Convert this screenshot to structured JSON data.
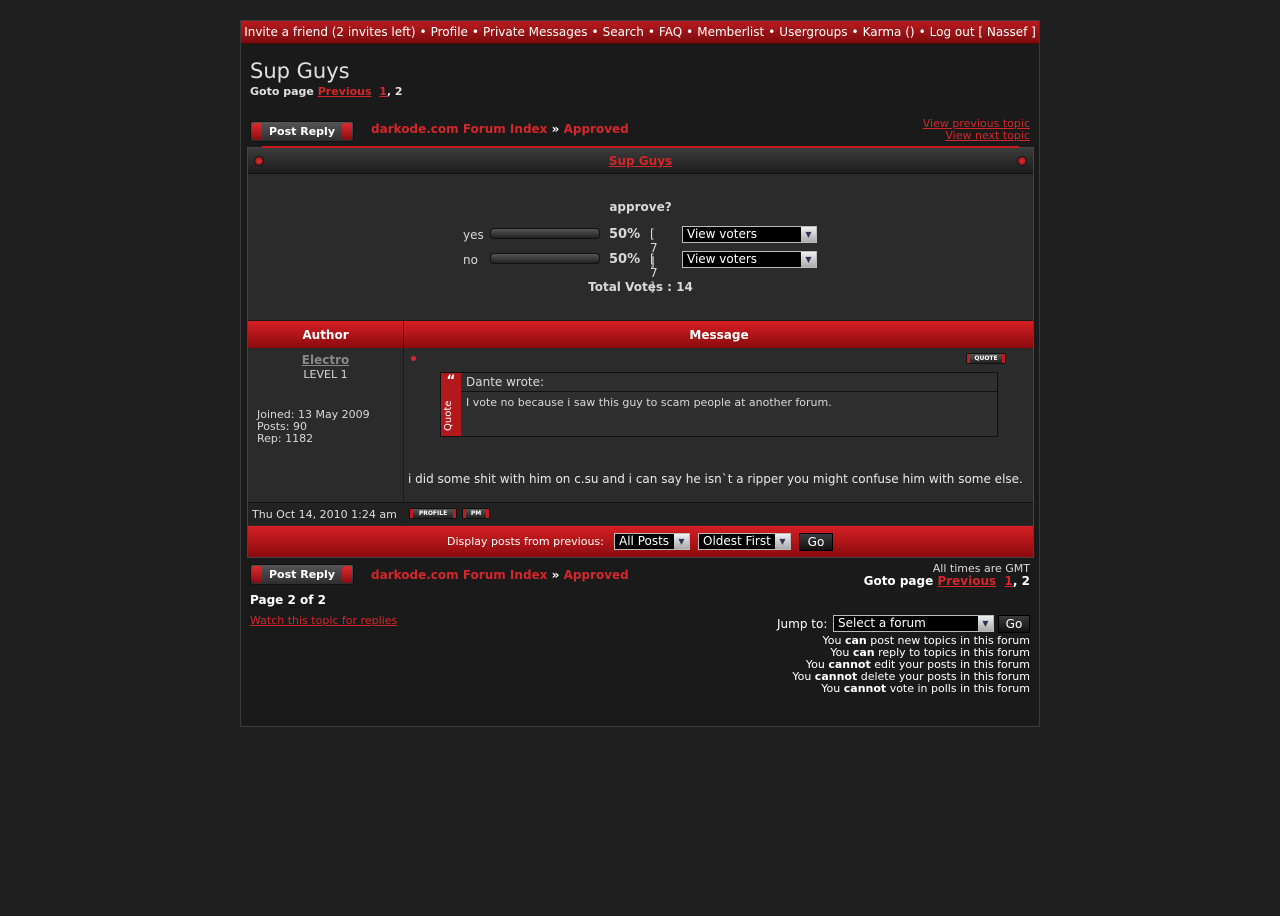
{
  "nav": {
    "invite": "Invite a friend (2 invites left)",
    "profile": "Profile",
    "pm": "Private Messages",
    "search": "Search",
    "faq": "FAQ",
    "memberlist": "Memberlist",
    "usergroups": "Usergroups",
    "karma": "Karma ()",
    "logout": "Log out [ Nassef ]",
    "sep": "•"
  },
  "topic": {
    "title": "Sup Guys",
    "goto_label": "Goto page",
    "previous": "Previous",
    "page1": "1",
    "page_sep": ",",
    "page2": "2"
  },
  "actions": {
    "post_reply": "Post Reply",
    "forum_index": "darkode.com Forum Index",
    "crumb_sep": "»",
    "forum": "Approved",
    "view_previous": "View previous topic",
    "view_next": "View next topic"
  },
  "poll": {
    "header": "Sup Guys",
    "question": "approve?",
    "options": [
      {
        "label": "yes",
        "percent": "50%",
        "count": "[ 7 ]",
        "select": "View voters"
      },
      {
        "label": "no",
        "percent": "50%",
        "count": "[ 7 ]",
        "select": "View voters"
      }
    ],
    "total": "Total Votes : 14"
  },
  "table": {
    "author_header": "Author",
    "message_header": "Message"
  },
  "post": {
    "username": "Electro",
    "level": "LEVEL 1",
    "joined": "Joined: 13 May 2009",
    "posts": "Posts: 90",
    "rep": "Rep: 1182",
    "quote_btn": "QUOTE",
    "quote_author": "Dante wrote:",
    "quote_side": "Quote",
    "quote_mark": "“",
    "quote_text": "I vote no because i saw this guy to scam people at another forum.",
    "text": "i did some shit with him on c.su and i can say he isn`t a ripper you might confuse him with some else.",
    "date": "Thu Oct 14, 2010 1:24 am",
    "profile_btn": "PROFILE",
    "pm_btn": "PM"
  },
  "display": {
    "label": "Display posts from previous:",
    "posts_select": "All Posts",
    "order_select": "Oldest First",
    "go": "Go",
    "arrow": "▼"
  },
  "footer": {
    "times": "All times are GMT",
    "goto_label": "Goto page",
    "previous": "Previous",
    "page1": "1",
    "page_sep": ",",
    "page2": "2",
    "page_of": "Page 2 of 2",
    "watch": "Watch this topic for replies",
    "jump_label": "Jump to:",
    "jump_select": "Select a forum",
    "jump_go": "Go",
    "you": "You",
    "can": "can",
    "cannot": "cannot",
    "perm1": "post new topics in this forum",
    "perm2": "reply to topics in this forum",
    "perm3": "edit your posts in this forum",
    "perm4": "delete your posts in this forum",
    "perm5": "vote in polls in this forum"
  }
}
